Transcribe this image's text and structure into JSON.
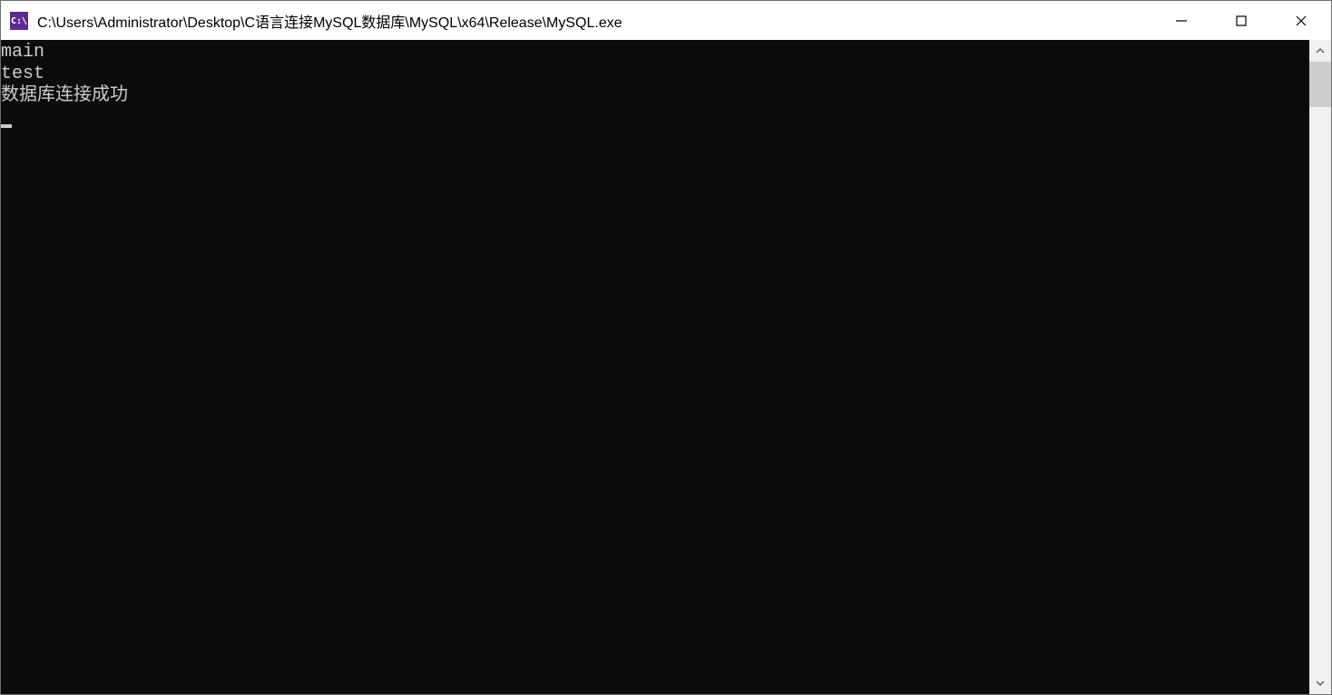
{
  "window": {
    "title": "C:\\Users\\Administrator\\Desktop\\C语言连接MySQL数据库\\MySQL\\x64\\Release\\MySQL.exe",
    "icon_label": "C:\\"
  },
  "console": {
    "lines": [
      "main",
      "test",
      "数据库连接成功"
    ]
  }
}
